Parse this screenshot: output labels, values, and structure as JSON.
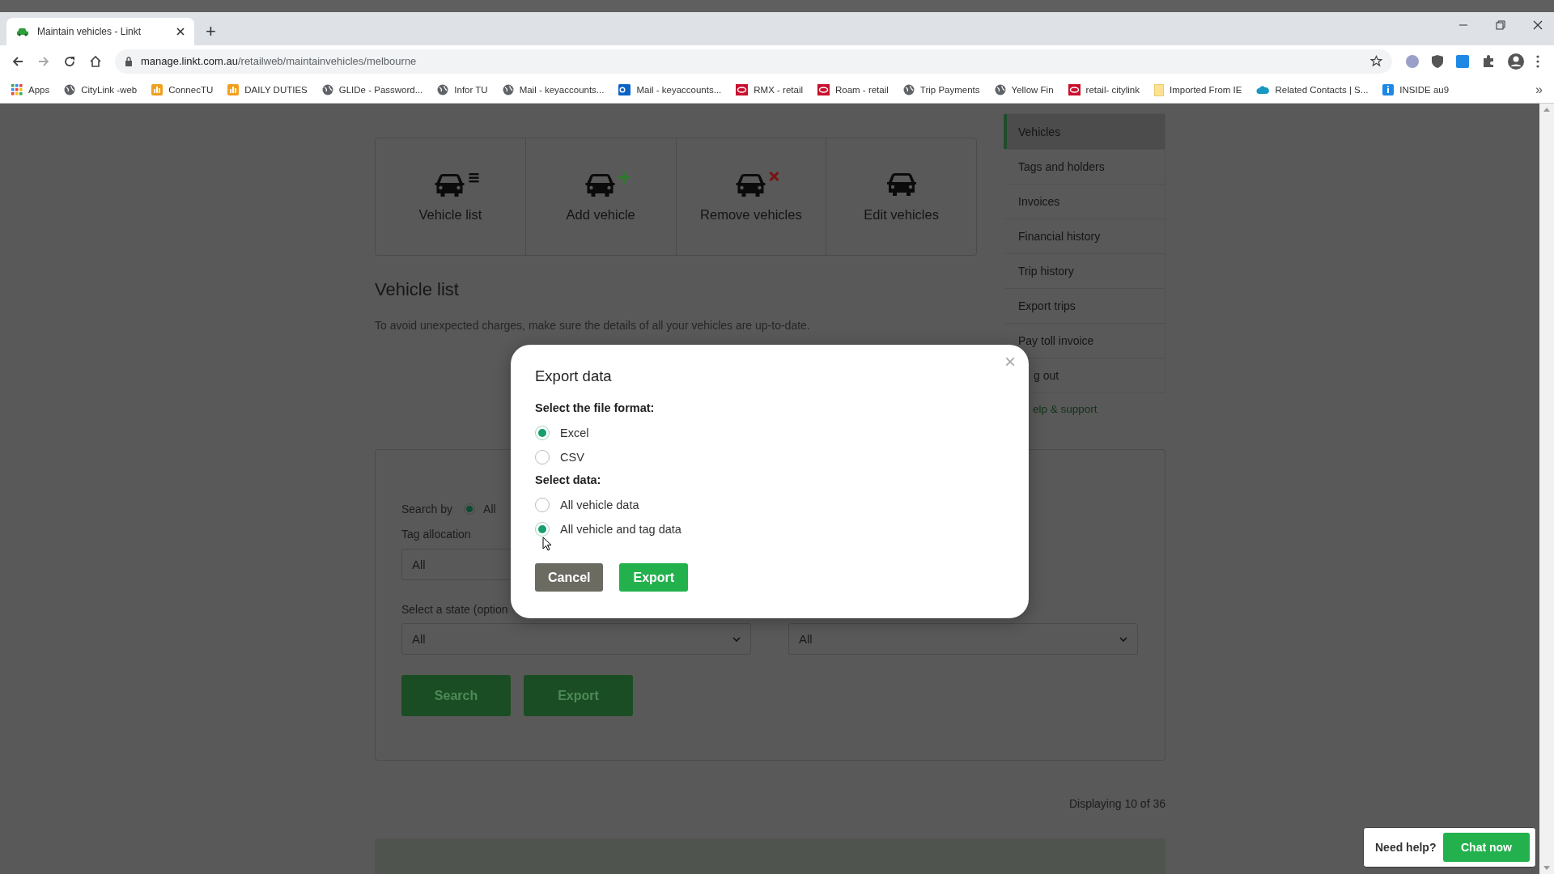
{
  "browser": {
    "tab": {
      "title": "Maintain vehicles - Linkt"
    },
    "new_tab": "+",
    "address": {
      "host": "manage.linkt.com.au",
      "path": "/retailweb/maintainvehicles/melbourne"
    },
    "bookmarks": [
      {
        "label": "Apps",
        "kind": "grid"
      },
      {
        "label": "CityLink -web",
        "kind": "globe"
      },
      {
        "label": "ConnecTU",
        "kind": "orange"
      },
      {
        "label": "DAILY DUTIES",
        "kind": "orange"
      },
      {
        "label": "GLIDe - Password...",
        "kind": "globe"
      },
      {
        "label": "Infor TU",
        "kind": "globe"
      },
      {
        "label": "Mail - keyaccounts...",
        "kind": "globe"
      },
      {
        "label": "Mail - keyaccounts...",
        "kind": "outlook"
      },
      {
        "label": "RMX - retail",
        "kind": "red"
      },
      {
        "label": "Roam - retail",
        "kind": "red"
      },
      {
        "label": "Trip Payments",
        "kind": "globe"
      },
      {
        "label": "Yellow Fin",
        "kind": "globe"
      },
      {
        "label": "retail- citylink",
        "kind": "red"
      },
      {
        "label": "Imported From IE",
        "kind": "folder"
      },
      {
        "label": "Related Contacts | S...",
        "kind": "cloud"
      },
      {
        "label": "INSIDE au9",
        "kind": "info"
      }
    ],
    "more": "»"
  },
  "tiles": [
    {
      "label": "Vehicle list",
      "kind": "list"
    },
    {
      "label": "Add vehicle",
      "kind": "plus"
    },
    {
      "label": "Remove vehicles",
      "kind": "cross"
    },
    {
      "label": "Edit vehicles",
      "kind": "plain"
    }
  ],
  "heading": "Vehicle list",
  "description": "To avoid unexpected charges, make sure the details of all your vehicles are up-to-date.",
  "sidebar": {
    "items": [
      {
        "label": "Vehicles",
        "selected": true
      },
      {
        "label": "Tags and holders",
        "selected": false
      },
      {
        "label": "Invoices",
        "selected": false
      },
      {
        "label": "Financial history",
        "selected": false
      },
      {
        "label": "Trip history",
        "selected": false
      },
      {
        "label": "Export trips",
        "selected": false
      },
      {
        "label": "Pay toll invoice",
        "selected": false
      },
      {
        "label": "g out",
        "selected": false
      }
    ],
    "help_link": "elp & support"
  },
  "form": {
    "search_by": {
      "label": "Search by",
      "options": [
        {
          "label": "All",
          "selected": true
        }
      ]
    },
    "tag_allocation": {
      "label": "Tag allocation",
      "value": "All"
    },
    "state": {
      "label": "Select a state (option",
      "value": "All"
    },
    "second_select": {
      "value": "All"
    },
    "buttons": [
      {
        "label": "Search"
      },
      {
        "label": "Export"
      }
    ]
  },
  "results_count": "Displaying 10 of 36",
  "modal": {
    "title": "Export data",
    "close": "×",
    "sections": [
      {
        "label": "Select the file format:",
        "options": [
          {
            "label": "Excel",
            "selected": true
          },
          {
            "label": "CSV",
            "selected": false
          }
        ]
      },
      {
        "label": "Select data:",
        "options": [
          {
            "label": "All vehicle data",
            "selected": false
          },
          {
            "label": "All vehicle and tag data",
            "selected": true
          }
        ]
      }
    ],
    "buttons": [
      {
        "label": "Cancel",
        "kind": "secondary"
      },
      {
        "label": "Export",
        "kind": "primary"
      }
    ]
  },
  "chat_widget": {
    "prompt": "Need help?",
    "button": "Chat now"
  }
}
